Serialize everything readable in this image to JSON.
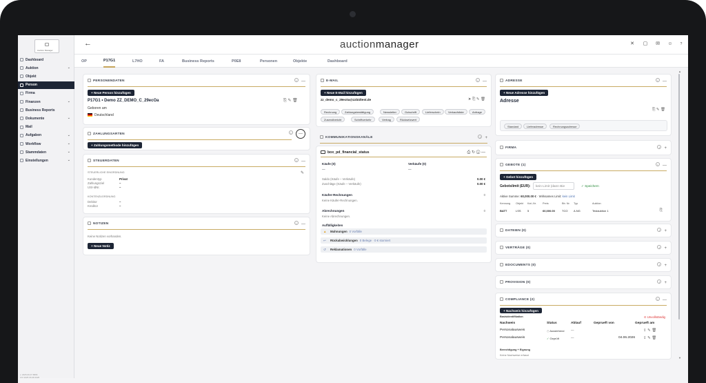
{
  "sidebar": {
    "logo_text": "Auction Manager",
    "items": [
      {
        "label": "Dashboard",
        "chevron": false,
        "active": false
      },
      {
        "label": "Auktion",
        "chevron": true,
        "active": false
      },
      {
        "label": "Objekt",
        "chevron": false,
        "active": false
      },
      {
        "label": "Person",
        "chevron": false,
        "active": true
      },
      {
        "label": "Firma",
        "chevron": false,
        "active": false
      },
      {
        "label": "Finanzen",
        "chevron": true,
        "active": false
      },
      {
        "label": "Business Reports",
        "chevron": false,
        "active": false
      },
      {
        "label": "Dokumente",
        "chevron": true,
        "active": false
      },
      {
        "label": "Mail",
        "chevron": false,
        "active": false
      },
      {
        "label": "Aufgaben",
        "chevron": true,
        "active": false
      },
      {
        "label": "Workflow",
        "chevron": true,
        "active": false
      },
      {
        "label": "Stammdaten",
        "chevron": true,
        "active": false
      },
      {
        "label": "Einstellungen",
        "chevron": true,
        "active": false
      }
    ],
    "footer_1": "v. 2025.06.07 8896",
    "footer_2": "IVV 2025 06 08 2025"
  },
  "topbar": {
    "back_glyph": "←",
    "brand_light": "auction",
    "brand_bold": "manager",
    "icons": [
      "translate-icon",
      "calendar-icon",
      "mail-icon",
      "user-icon",
      "help-icon"
    ]
  },
  "tabs": [
    {
      "label": "OP",
      "active": false
    },
    {
      "label": "P17G1",
      "active": true
    },
    {
      "label": "L7HO",
      "active": false
    },
    {
      "label": "FA",
      "active": false
    },
    {
      "label": "Business Reports",
      "active": false
    },
    {
      "label": "P0E8",
      "active": false
    },
    {
      "label": "Personen",
      "active": false
    },
    {
      "label": "Objekte",
      "active": false
    },
    {
      "label": "Dashboard",
      "active": false
    }
  ],
  "personendaten": {
    "title": "PERSONENDATEN",
    "add_button": "+ Neue Person hinzufügen",
    "name": "P17G1 • Demo ZZ_DEMO_C_29ecOa",
    "born_label": "Geboren am",
    "country": "Deutschland"
  },
  "zahlungsarten": {
    "title": "ZAHLUNGSARTEN",
    "add_button": "+ Zahlungsmethode hinzufügen"
  },
  "steuerdaten": {
    "title": "STEUERDATEN",
    "section1": "STEUERLICHE EINORDNUNG",
    "rows1": [
      {
        "label": "Kundentyp",
        "value": "Privat"
      },
      {
        "label": "Zahlungsziel",
        "value": "–"
      },
      {
        "label": "USt-IdNr.",
        "value": "–"
      }
    ],
    "section2": "KONTENZUORDNUNG",
    "rows2": [
      {
        "label": "Debitor",
        "value": "–"
      },
      {
        "label": "Kreditor",
        "value": "–"
      }
    ]
  },
  "notizen": {
    "title": "NOTIZEN",
    "empty_text": "Keine Notizen vorhanden.",
    "add_button": "+ Neue Notiz"
  },
  "email": {
    "title": "E-MAIL",
    "add_button": "+ Neue E-Mail hinzufügen",
    "address": "zz_demo_c_29ec0a@zzbidtest.de",
    "chips": [
      "Rechnung",
      "Zahlungsbestätigung",
      "Newsletter",
      "Gutschrift",
      "Lieferschein",
      "Verkaufsliste",
      "Anfrage",
      "Zusendbericht",
      "Schriftverkehr",
      "Vertrag",
      "Rücksetzwert"
    ]
  },
  "kommunikation": {
    "title": "KOMMUNIKATIONSKANÄLE"
  },
  "financial": {
    "title": "box_pd_financial_status",
    "kaeufe_label": "Käufe (0)",
    "kaeufe_value": "—",
    "verkaeufe_label": "Verkäufe (0)",
    "verkaeufe_value": "—",
    "saldo_label": "Saldo (Käufe – Verkäufe)",
    "saldo_value": "0.00 €",
    "zuschlaege_label": "Zuschläge (Käufe – Verkäufe)",
    "zuschlaege_value": "0.00 €",
    "kaeufer_title": "Käufer-Rechnungen",
    "kaeufer_count": "0",
    "kaeufer_empty": "Keine Käufer-Rechnungen.",
    "abrechnungen_title": "Abrechnungen",
    "abrechnungen_count": "0",
    "abrechnungen_empty": "Keine Abrechnungen.",
    "auffaellig_title": "Auffälligkeiten",
    "rows": [
      {
        "bold": "Mahnungen",
        "rest": "0 Vorfälle"
      },
      {
        "bold": "Rückabwicklungen",
        "rest": "0 Belege · 0 € storniert"
      },
      {
        "bold": "Reklamationen",
        "rest": "0 Vorfälle"
      }
    ]
  },
  "adresse": {
    "title": "ADRESSE",
    "add_button": "+ Neue Adresse hinzufügen",
    "heading": "Adresse",
    "chips": [
      "Standard",
      "Lieferadresse",
      "Rechnungsadresse"
    ]
  },
  "firma": {
    "title": "FIRMA"
  },
  "gebote": {
    "title": "GEBOTE (1)",
    "add_button": "+ Gebot hinzufügen",
    "limit_label": "Gebotslimit (EUR):",
    "limit_placeholder": "kein Limit (dann Bie",
    "save_label": "Speichern",
    "summary_pre": "Aktive Summe:",
    "summary_value": "60,000.00 €",
    "summary_mid": "· Wirksames Limit:",
    "summary_link": "kein Limit",
    "headers": [
      "Kennung",
      "Objekt",
      "Kat.-Nr.",
      "Preis",
      "Btr. Nr.",
      "Typ",
      "Auktion"
    ],
    "row": [
      "BATT",
      "LSS",
      "5",
      "60,000.00",
      "TCO",
      "A.NG",
      "Testauktion 1"
    ]
  },
  "dateien": {
    "title": "DATEIEN (0)"
  },
  "vertraege": {
    "title": "VERTRÄGE (0)"
  },
  "edocuments": {
    "title": "EDOCUMENTS (0)"
  },
  "provision": {
    "title": "PROVISION (0)"
  },
  "compliance": {
    "title": "COMPLIANCE (2)",
    "add_button": "+ Nachweis hinzufügen",
    "status_warn": "Unvollständig",
    "subtitle": "Basisidentifikation",
    "headers": [
      "Nachweis",
      "Status",
      "Ablauf",
      "Geprueft von",
      "Geprueft am"
    ],
    "rows": [
      {
        "name": "Personalausweis",
        "status": "Ausstehend",
        "ablauf": "—",
        "date": ""
      },
      {
        "name": "Personalausweis",
        "status": "Geprüft",
        "ablauf": "—",
        "date": "04.06.2026"
      }
    ],
    "section2": "Berechtigung + Eignung",
    "section2_empty": "Keine Nachweise erfasst"
  }
}
